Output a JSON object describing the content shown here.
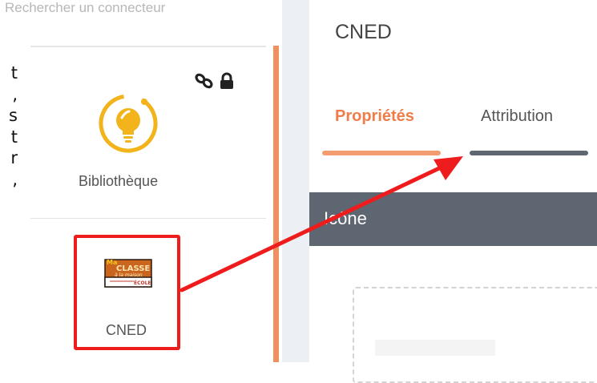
{
  "left_overflow_text": [
    "t",
    ",",
    "s",
    "t",
    "r",
    ","
  ],
  "search": {
    "placeholder": "Rechercher un connecteur"
  },
  "connectors": [
    {
      "label": "Bibliothèque",
      "icons": [
        "link-icon",
        "lock-icon"
      ],
      "icon": "lightbulb-refresh-icon"
    },
    {
      "label": "CNED",
      "icon": "ma-classe-a-la-maison-logo",
      "logo_text": [
        "Ma",
        "CLASSE",
        "à la maison",
        "ÉCOLE"
      ]
    }
  ],
  "detail": {
    "title": "CNED",
    "tabs": [
      {
        "label": "Propriétés",
        "active": true
      },
      {
        "label": "Attribution",
        "active": false
      }
    ],
    "section_label": "Icône"
  },
  "colors": {
    "accent": "#ef7d4a",
    "highlight": "#ee1c1c",
    "section": "#5e6672",
    "bulb": "#f2b31b"
  }
}
